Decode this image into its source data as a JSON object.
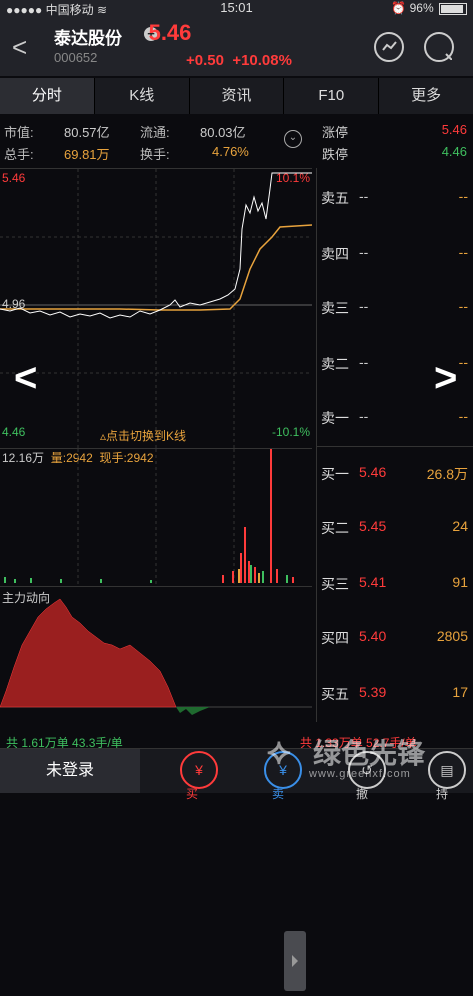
{
  "status": {
    "carrier": "中国移动",
    "time": "15:01",
    "battery": "96%"
  },
  "header": {
    "name": "泰达股份",
    "code": "000652",
    "price": "5.46",
    "change": "+0.50",
    "pct": "+10.08%"
  },
  "tabs": [
    "分时",
    "K线",
    "资讯",
    "F10",
    "更多"
  ],
  "info": {
    "mkt_cap_label": "市值:",
    "mkt_cap": "80.57亿",
    "float_label": "流通:",
    "float": "80.03亿",
    "vol_label": "总手:",
    "vol": "69.81万",
    "turnover_label": "换手:",
    "turnover": "4.76%"
  },
  "limits": {
    "up_label": "涨停",
    "up": "5.46",
    "down_label": "跌停",
    "down": "4.46"
  },
  "chart": {
    "top_left": "5.46",
    "top_right": "10.1%",
    "mid_left": "4.96",
    "bottom_left": "4.46",
    "bottom_right": "-10.1%",
    "switch_hint": "点击切换到K线"
  },
  "volume": {
    "max": "12.16万",
    "vol_label": "量:",
    "vol": "2942",
    "now_label": "现手:",
    "now": "2942"
  },
  "flow": {
    "title": "主力动向"
  },
  "book": {
    "asks": [
      {
        "name": "卖五",
        "price": "--",
        "vol": "--"
      },
      {
        "name": "卖四",
        "price": "--",
        "vol": "--"
      },
      {
        "name": "卖三",
        "price": "--",
        "vol": "--"
      },
      {
        "name": "卖二",
        "price": "--",
        "vol": "--"
      },
      {
        "name": "卖一",
        "price": "--",
        "vol": "--"
      }
    ],
    "bids": [
      {
        "name": "买一",
        "price": "5.46",
        "vol": "26.8万"
      },
      {
        "name": "买二",
        "price": "5.45",
        "vol": "24"
      },
      {
        "name": "买三",
        "price": "5.41",
        "vol": "91"
      },
      {
        "name": "买四",
        "price": "5.40",
        "vol": "2805"
      },
      {
        "name": "买五",
        "price": "5.39",
        "vol": "17"
      }
    ]
  },
  "summary": {
    "left": "共 1.61万单  43.3手/单",
    "right": "共 1.33万单  52.7手/单"
  },
  "bottom": {
    "login": "未登录",
    "buy": "买",
    "sell": "卖",
    "cancel": "撤",
    "hold": "持"
  },
  "watermark": {
    "title": "绿色先锋",
    "url": "www.greenxf.com"
  },
  "colors": {
    "up": "#ff3b3b",
    "down": "#3fbf5f",
    "avg": "#e8a33d"
  }
}
